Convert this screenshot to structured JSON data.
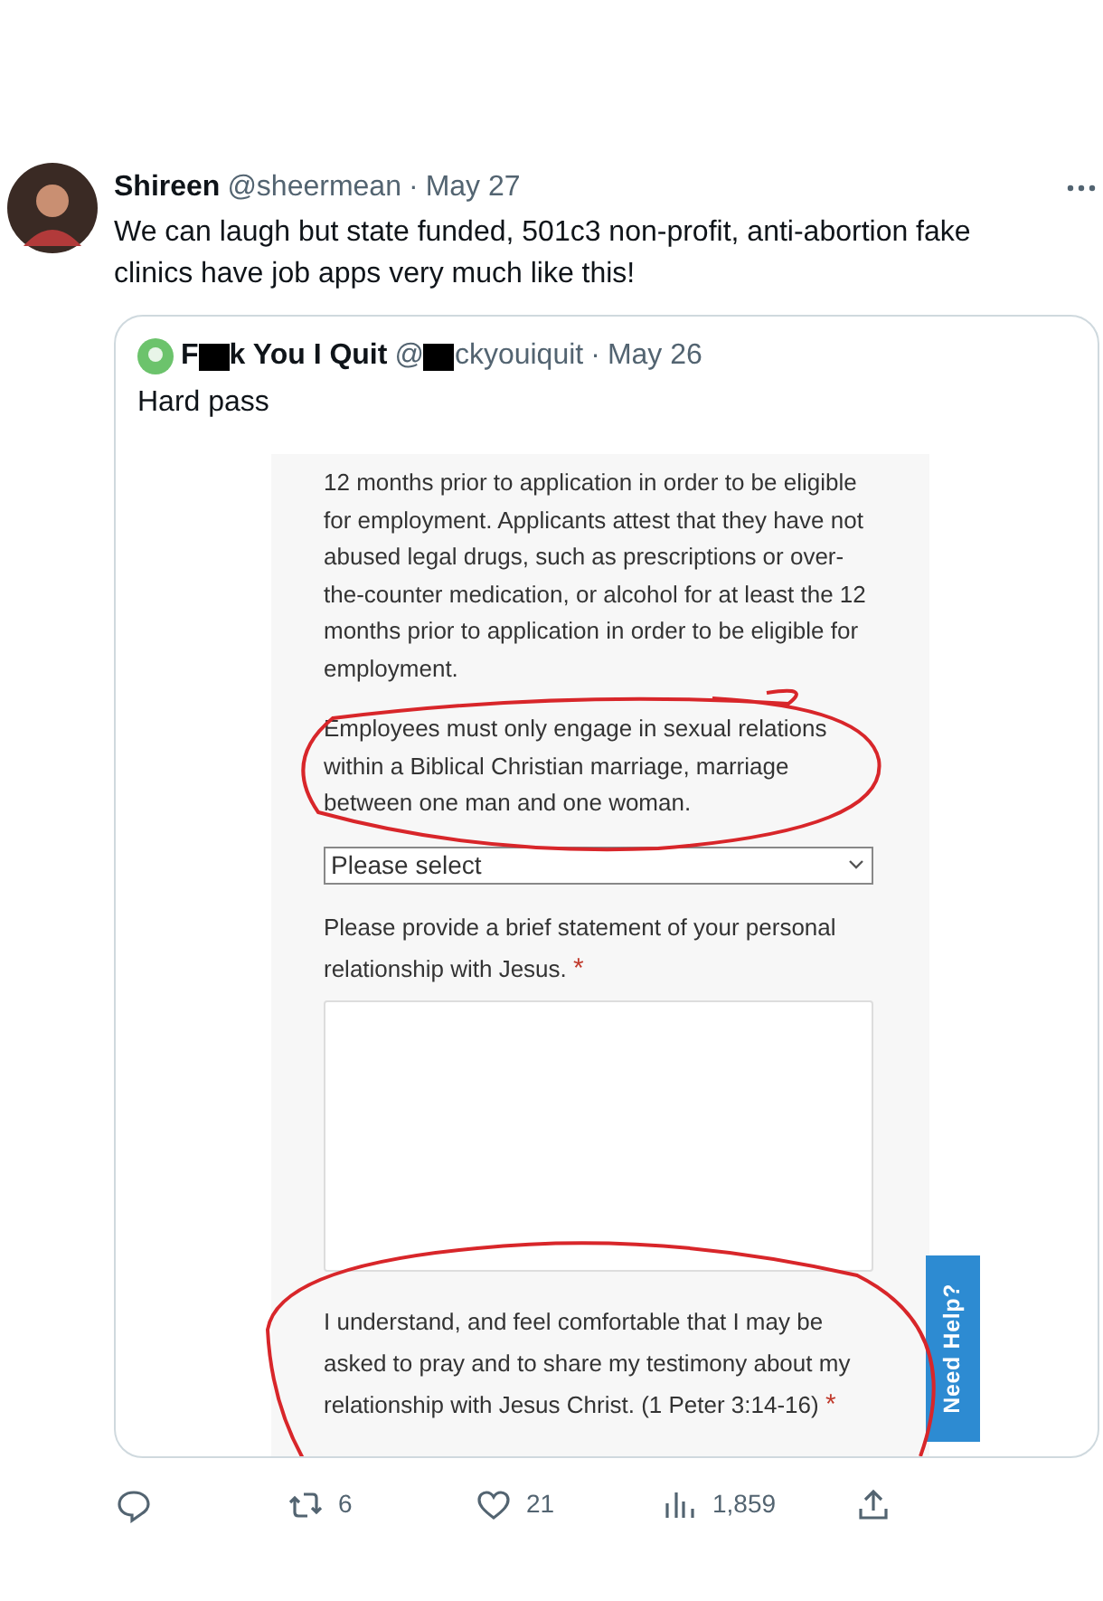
{
  "author": {
    "name": "Shireen",
    "handle": "@sheermean",
    "date": "May 27"
  },
  "separator": "·",
  "text": "We can laugh but state funded, 501c3 non-profit, anti-abortion fake clinics have job apps very much like this!",
  "quoted": {
    "name_parts": [
      "F",
      "k You I Quit"
    ],
    "handle_parts": [
      "@",
      "ckyouiquit"
    ],
    "date": "May 26",
    "text": "Hard pass",
    "form": {
      "fields": [
        {
          "kind": "paragraph",
          "text": "12 months prior to application in order to be eligible for employment. Applicants attest that they have not abused legal drugs, such as prescriptions or over-the-counter medication, or alcohol for at least the 12 months prior to application in order to be eligible for employment."
        },
        {
          "kind": "paragraph",
          "text": "Employees must only engage in sexual relations within a Biblical Christian marriage, marriage between one man and one woman."
        },
        {
          "kind": "select",
          "value": "Please select"
        },
        {
          "kind": "label",
          "text": "Please provide a brief statement of your personal relationship with Jesus.",
          "required": true
        },
        {
          "kind": "textarea"
        },
        {
          "kind": "label",
          "text": "I understand, and feel comfortable that I may be asked to pray and to share my testimony about my relationship with Jesus Christ. (1 Peter 3:14-16)",
          "required": true
        }
      ],
      "required_mark": "*",
      "help_tab": "Need Help?"
    }
  },
  "actions": [
    {
      "kind": "reply"
    },
    {
      "kind": "retweet",
      "count": "6"
    },
    {
      "kind": "like",
      "count": "21"
    },
    {
      "kind": "views",
      "count": "1,859"
    },
    {
      "kind": "share"
    }
  ]
}
